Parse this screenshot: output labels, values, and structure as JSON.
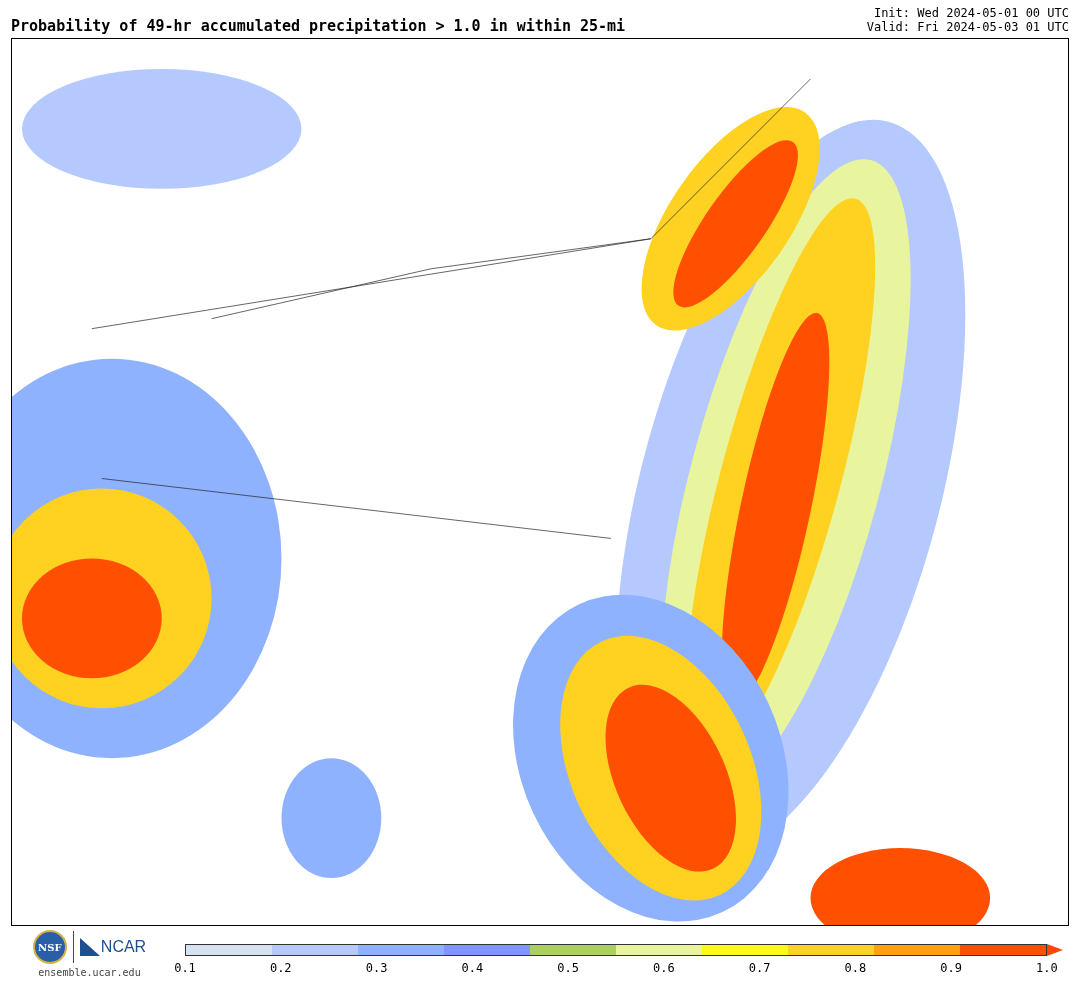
{
  "title": "Probability of 49-hr accumulated precipitation > 1.0 in within 25-mi",
  "init": "Init: Wed 2024-05-01 00 UTC",
  "valid": "Valid: Fri 2024-05-03 01 UTC",
  "logos": {
    "nsf": "NSF",
    "ncar": "NCAR",
    "site": "ensemble.ucar.edu"
  },
  "colorbar": {
    "segments": [
      {
        "color": "#d6e2ee"
      },
      {
        "color": "#b5c9ff"
      },
      {
        "color": "#8fb2ff"
      },
      {
        "color": "#7f96ff"
      },
      {
        "color": "#abcf63"
      },
      {
        "color": "#e8f59e"
      },
      {
        "color": "#fffa14"
      },
      {
        "color": "#ffd121"
      },
      {
        "color": "#ffa30a"
      },
      {
        "color": "#ff4f00"
      }
    ],
    "ticks": [
      "0.1",
      "0.2",
      "0.3",
      "0.4",
      "0.5",
      "0.6",
      "0.7",
      "0.8",
      "0.9",
      "1.0"
    ],
    "over_arrow": {
      "color": "#ff4500"
    }
  }
}
